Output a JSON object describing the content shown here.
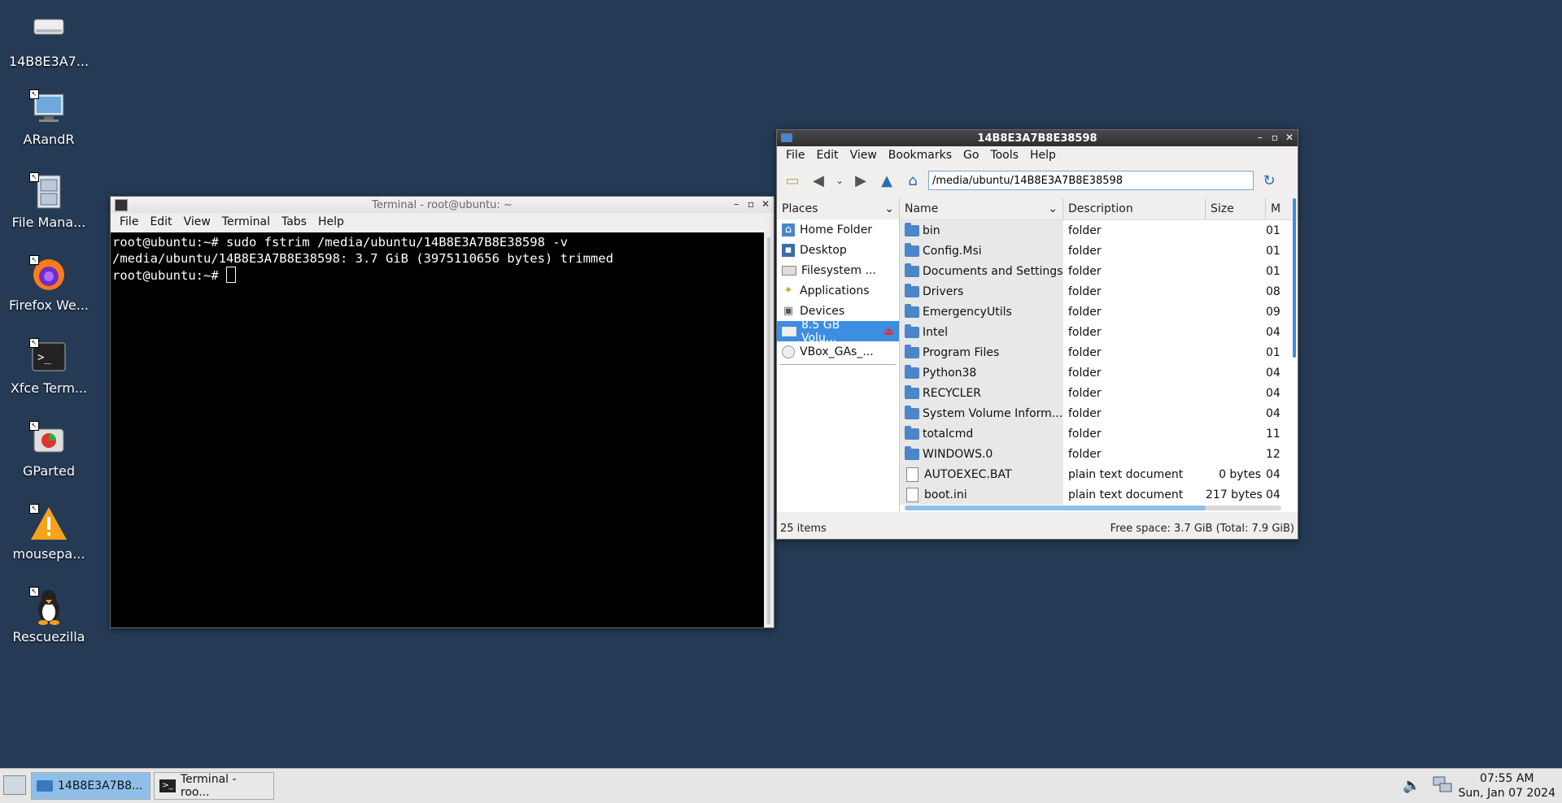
{
  "desktop": {
    "icons": [
      {
        "label": "14B8E3A7...",
        "icon": "drive-icon"
      },
      {
        "label": "ARandR",
        "icon": "display-icon"
      },
      {
        "label": "File Mana...",
        "icon": "file-cabinet-icon"
      },
      {
        "label": "Firefox We...",
        "icon": "firefox-icon"
      },
      {
        "label": "Xfce Term...",
        "icon": "terminal-icon"
      },
      {
        "label": "GParted",
        "icon": "gparted-icon"
      },
      {
        "label": "mousepa...",
        "icon": "warning-icon"
      },
      {
        "label": "Rescuezilla",
        "icon": "penguin-icon"
      }
    ]
  },
  "terminal": {
    "title": "Terminal - root@ubuntu: ~",
    "menu": [
      "File",
      "Edit",
      "View",
      "Terminal",
      "Tabs",
      "Help"
    ],
    "lines": [
      "root@ubuntu:~# sudo fstrim /media/ubuntu/14B8E3A7B8E38598 -v",
      "/media/ubuntu/14B8E3A7B8E38598: 3.7 GiB (3975110656 bytes) trimmed",
      "root@ubuntu:~# "
    ]
  },
  "filemanager": {
    "title": "14B8E3A7B8E38598",
    "menu": [
      "File",
      "Edit",
      "View",
      "Bookmarks",
      "Go",
      "Tools",
      "Help"
    ],
    "address": "/media/ubuntu/14B8E3A7B8E38598",
    "places_header": "Places",
    "places": [
      {
        "label": "Home Folder",
        "icon": "home-icon"
      },
      {
        "label": "Desktop",
        "icon": "desktop-icon"
      },
      {
        "label": "Filesystem ...",
        "icon": "drive-icon"
      },
      {
        "label": "Applications",
        "icon": "applications-icon"
      },
      {
        "label": "Devices",
        "icon": "computer-icon"
      },
      {
        "label": "8.5 GB Volu...",
        "icon": "drive-icon",
        "selected": true
      },
      {
        "label": "VBox_GAs_...",
        "icon": "disc-icon"
      }
    ],
    "columns": [
      "Name",
      "Description",
      "Size",
      "M"
    ],
    "rows": [
      {
        "name": "bin",
        "desc": "folder",
        "size": "",
        "mod": "01",
        "type": "folder"
      },
      {
        "name": "Config.Msi",
        "desc": "folder",
        "size": "",
        "mod": "01",
        "type": "folder"
      },
      {
        "name": "Documents and Settings",
        "desc": "folder",
        "size": "",
        "mod": "01",
        "type": "folder"
      },
      {
        "name": "Drivers",
        "desc": "folder",
        "size": "",
        "mod": "08",
        "type": "folder"
      },
      {
        "name": "EmergencyUtils",
        "desc": "folder",
        "size": "",
        "mod": "09",
        "type": "folder"
      },
      {
        "name": "Intel",
        "desc": "folder",
        "size": "",
        "mod": "04",
        "type": "folder"
      },
      {
        "name": "Program Files",
        "desc": "folder",
        "size": "",
        "mod": "01",
        "type": "folder"
      },
      {
        "name": "Python38",
        "desc": "folder",
        "size": "",
        "mod": "04",
        "type": "folder"
      },
      {
        "name": "RECYCLER",
        "desc": "folder",
        "size": "",
        "mod": "04",
        "type": "folder"
      },
      {
        "name": "System Volume Inform...",
        "desc": "folder",
        "size": "",
        "mod": "04",
        "type": "folder"
      },
      {
        "name": "totalcmd",
        "desc": "folder",
        "size": "",
        "mod": "11",
        "type": "folder"
      },
      {
        "name": "WINDOWS.0",
        "desc": "folder",
        "size": "",
        "mod": "12",
        "type": "folder"
      },
      {
        "name": "AUTOEXEC.BAT",
        "desc": "plain text document",
        "size": "0 bytes",
        "mod": "04",
        "type": "file"
      },
      {
        "name": "boot.ini",
        "desc": "plain text document",
        "size": "217 bytes",
        "mod": "04",
        "type": "file"
      }
    ],
    "status_left": "25 items",
    "status_right": "Free space: 3.7 GiB (Total: 7.9 GiB)"
  },
  "taskbar": {
    "tasks": [
      "14B8E3A7B8...",
      "Terminal - roo..."
    ],
    "time": "07:55 AM",
    "date": "Sun, Jan 07 2024"
  }
}
